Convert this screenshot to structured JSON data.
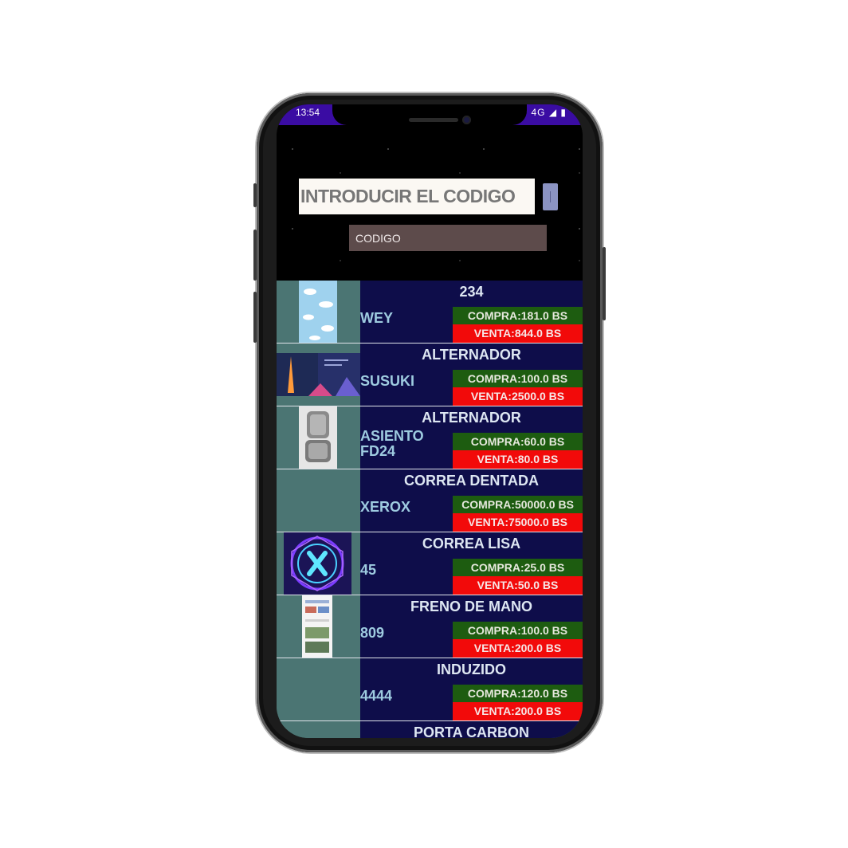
{
  "status_bar": {
    "time": "13:54",
    "network": "4G"
  },
  "header": {
    "code_label": "INTRODUCIR EL CODIGO",
    "code_input": {
      "placeholder": "CODIGO",
      "value": ""
    }
  },
  "products": [
    {
      "name": "234",
      "code": "WEY",
      "compra": "COMPRA:181.0 BS",
      "venta": "VENTA:844.0 BS"
    },
    {
      "name": "ALTERNADOR",
      "code": "SUSUKI",
      "compra": "COMPRA:100.0 BS",
      "venta": "VENTA:2500.0 BS"
    },
    {
      "name": "ALTERNADOR",
      "code": "ASIENTO FD24",
      "compra": "COMPRA:60.0 BS",
      "venta": "VENTA:80.0 BS"
    },
    {
      "name": "CORREA DENTADA",
      "code": "XEROX",
      "compra": "COMPRA:50000.0 BS",
      "venta": "VENTA:75000.0 BS"
    },
    {
      "name": "CORREA LISA",
      "code": "45",
      "compra": "COMPRA:25.0 BS",
      "venta": "VENTA:50.0 BS"
    },
    {
      "name": "FRENO DE MANO",
      "code": "809",
      "compra": "COMPRA:100.0 BS",
      "venta": "VENTA:200.0 BS"
    },
    {
      "name": "INDUZIDO",
      "code": "4444",
      "compra": "COMPRA:120.0 BS",
      "venta": "VENTA:200.0 BS"
    },
    {
      "name": "PORTA CARBON"
    }
  ],
  "colors": {
    "status_bar": "#3a0ca3",
    "row_info_bg": "#0e0d4a",
    "thumb_col_bg": "#4b7573",
    "compra_bg": "#1d5c10",
    "venta_bg": "#f20a0a",
    "input_bg": "#5d4b4b"
  }
}
